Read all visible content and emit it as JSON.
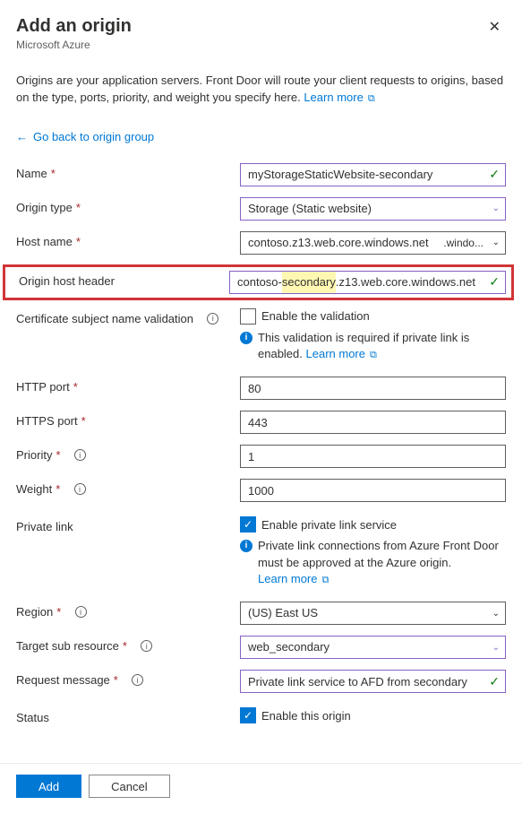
{
  "header": {
    "title": "Add an origin",
    "subtitle": "Microsoft Azure"
  },
  "description": {
    "text": "Origins are your application servers. Front Door will route your client requests to origins, based on the type, ports, priority, and weight you specify here. ",
    "learn_more": "Learn more"
  },
  "back_link": "Go back to origin group",
  "labels": {
    "name": "Name",
    "origin_type": "Origin type",
    "host_name": "Host name",
    "origin_host_header": "Origin host header",
    "cert_validation": "Certificate subject name validation",
    "http_port": "HTTP port",
    "https_port": "HTTPS port",
    "priority": "Priority",
    "weight": "Weight",
    "private_link": "Private link",
    "region": "Region",
    "target_sub": "Target sub resource",
    "request_msg": "Request message",
    "status": "Status"
  },
  "values": {
    "name": "myStorageStaticWebsite-secondary",
    "origin_type": "Storage (Static website)",
    "host_name": "contoso.z13.web.core.windows.net",
    "host_overlay": ".windo...",
    "origin_host_header_pre": "contoso-",
    "origin_host_header_mark": "secondary",
    "origin_host_header_post": ".z13.web.core.windows.net",
    "http_port": "80",
    "https_port": "443",
    "priority": "1",
    "weight": "1000",
    "region": "(US) East US",
    "target_sub": "web_secondary",
    "request_msg": "Private link service to AFD from secondary"
  },
  "checkboxes": {
    "enable_validation": {
      "checked": false,
      "label": "Enable the validation"
    },
    "enable_private_link": {
      "checked": true,
      "label": "Enable private link service"
    },
    "enable_origin": {
      "checked": true,
      "label": "Enable this origin"
    }
  },
  "helpers": {
    "validation": "This validation is required if private link is enabled. ",
    "validation_link": "Learn more",
    "private_link": "Private link connections from Azure Front Door must be approved at the Azure origin.",
    "private_link_link": "Learn more"
  },
  "footer": {
    "add": "Add",
    "cancel": "Cancel"
  }
}
